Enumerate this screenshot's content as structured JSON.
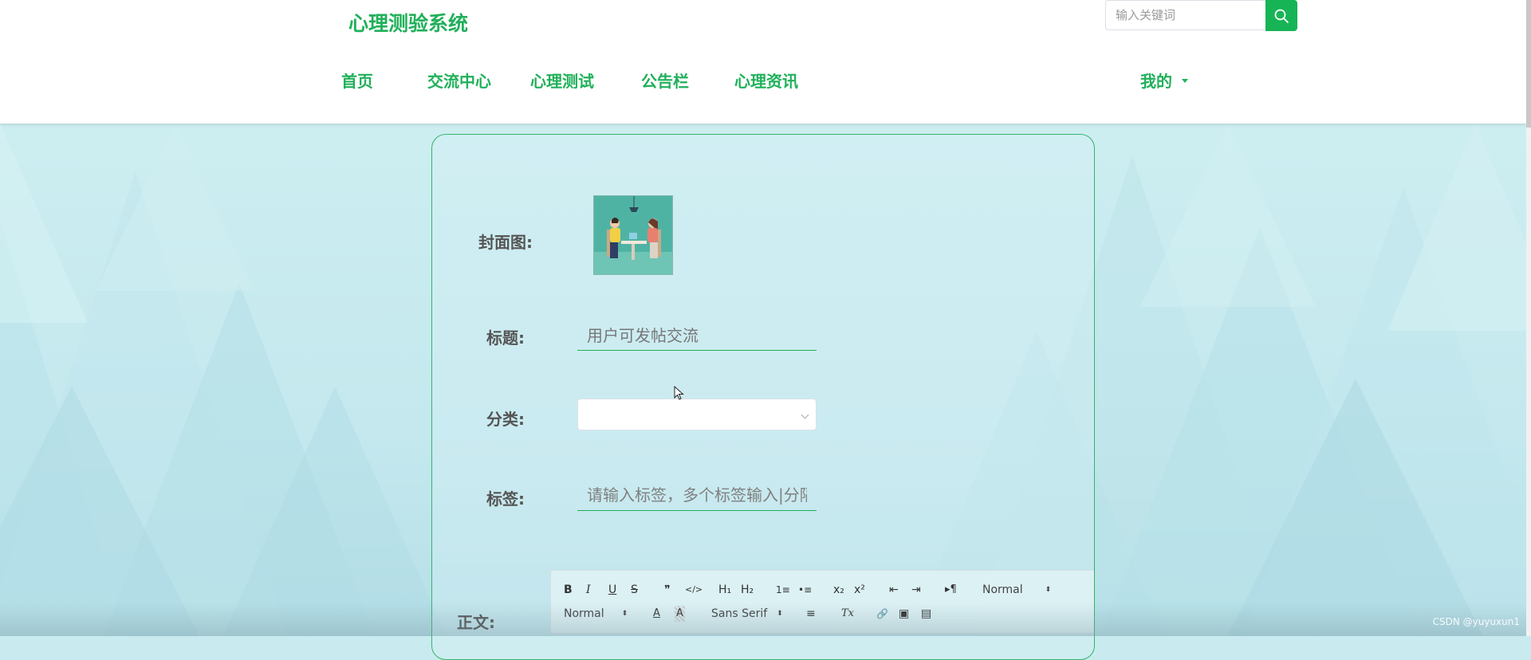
{
  "header": {
    "logo": "心理测验系统",
    "search": {
      "placeholder": "输入关键词",
      "button_icon": "search-icon"
    },
    "nav": [
      {
        "label": "首页"
      },
      {
        "label": "交流中心"
      },
      {
        "label": "心理测试"
      },
      {
        "label": "公告栏"
      },
      {
        "label": "心理资讯"
      }
    ],
    "user_menu": {
      "label": "我的",
      "icon": "caret-down-icon"
    }
  },
  "form": {
    "cover_label": "封面图:",
    "title_label": "标题:",
    "title_value": "用户可发帖交流",
    "category_label": "分类:",
    "category_value": "",
    "tags_label": "标签:",
    "tags_placeholder": "请输入标签，多个标签输入|分隔",
    "body_label": "正文:"
  },
  "editor_toolbar": {
    "bold": "B",
    "italic": "I",
    "underline": "U",
    "strike": "S",
    "blockquote": "❞",
    "code": "</>",
    "h1": "H₁",
    "h2": "H₂",
    "ordered_list": "1≡",
    "bullet_list": "•≡",
    "subscript": "x₂",
    "superscript": "x²",
    "outdent": "⇤",
    "indent": "⇥",
    "direction": "▸¶",
    "size_picker": "Normal",
    "header_picker": "Normal",
    "font_picker": "Sans Serif",
    "color": "A",
    "background": "A",
    "align": "≡",
    "clean": "Tx",
    "link": "🔗",
    "image": "▣",
    "video": "▤"
  },
  "watermark": "CSDN @yuyuxun1",
  "colors": {
    "brand": "#20b05a",
    "search_button": "#17b456",
    "card_border": "#34b469"
  }
}
